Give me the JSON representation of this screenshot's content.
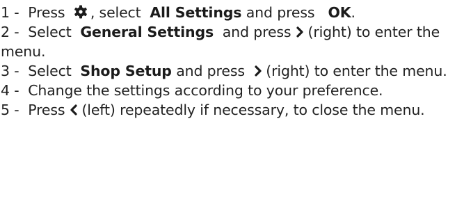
{
  "steps": [
    {
      "num": "1 -",
      "t1": "Press",
      "icon": "gear-icon",
      "t2": ", select",
      "b1": "All Settings",
      "t3": "and press",
      "b2": "OK",
      "t4": "."
    },
    {
      "num": "2 -",
      "t1": "Select",
      "b1": "General Settings",
      "t2": "and press",
      "icon": "chevron-right-icon",
      "t3": "(right) to enter the menu."
    },
    {
      "num": "3 -",
      "t1": "Select",
      "b1": "Shop Setup",
      "t2": "and press",
      "icon": "chevron-right-icon",
      "t3": "(right) to enter the menu."
    },
    {
      "num": "4 -",
      "t1": "Change the settings according to your preference."
    },
    {
      "num": "5 -",
      "t1": "Press",
      "icon": "chevron-left-icon",
      "t2": "(left) repeatedly if necessary, to close the menu."
    }
  ]
}
